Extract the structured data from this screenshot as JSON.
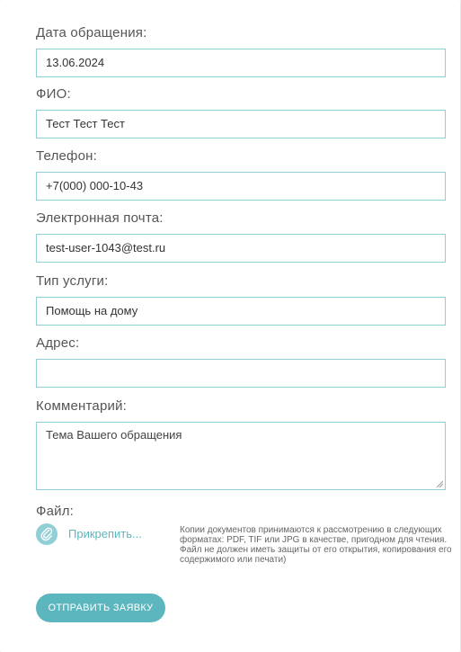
{
  "form": {
    "fields": [
      {
        "label": "Дата обращения:",
        "value": "13.06.2024"
      },
      {
        "label": "ФИО:",
        "value": "Тест Тест Тест"
      },
      {
        "label": "Телефон:",
        "value": "+7(000) 000-10-43"
      },
      {
        "label": "Электронная почта:",
        "value": "test-user-1043@test.ru"
      },
      {
        "label": "Тип услуги:",
        "value": "Помощь на дому"
      },
      {
        "label": "Адрес:",
        "value": ""
      },
      {
        "label": "Комментарий:",
        "value": "Тема Вашего обращения"
      }
    ],
    "file": {
      "label": "Файл:",
      "attach_label": "Прикрепить...",
      "icon": "paperclip-icon",
      "hint": "Копии документов принимаются к рассмотрению в следующих форматах: PDF, TIF или JPG в качестве, пригодном для чтения. Файл не должен иметь защиты от его открытия, копирования его содержимого или печати)"
    },
    "submit_label": "ОТПРАВИТЬ ЗАЯВКУ"
  },
  "colors": {
    "accent": "#5cb6bd",
    "field_border": "#8fcfd5"
  }
}
